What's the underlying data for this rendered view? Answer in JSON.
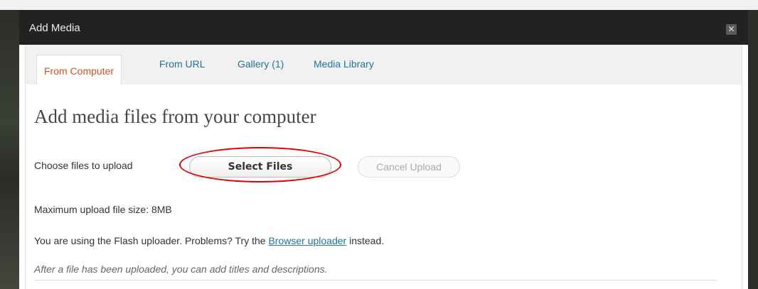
{
  "dialog": {
    "title": "Add Media",
    "close_glyph": "✕"
  },
  "tabs": [
    {
      "label": "From Computer",
      "active": true
    },
    {
      "label": "From URL",
      "active": false
    },
    {
      "label": "Gallery (1)",
      "active": false
    },
    {
      "label": "Media Library",
      "active": false
    }
  ],
  "content": {
    "heading": "Add media files from your computer",
    "choose_label": "Choose files to upload",
    "select_button": "Select Files",
    "cancel_button": "Cancel Upload",
    "max_size": "Maximum upload file size: 8MB",
    "flash_prefix": "You are using the Flash uploader. Problems? Try the",
    "browser_link": "Browser uploader",
    "flash_suffix": "instead.",
    "hint": "After a file has been uploaded, you can add titles and descriptions."
  },
  "colors": {
    "titlebar": "#222222",
    "active_tab": "#d54e21",
    "link": "#21759b",
    "highlight": "#e10000"
  },
  "icons": {
    "close": "close-icon"
  }
}
